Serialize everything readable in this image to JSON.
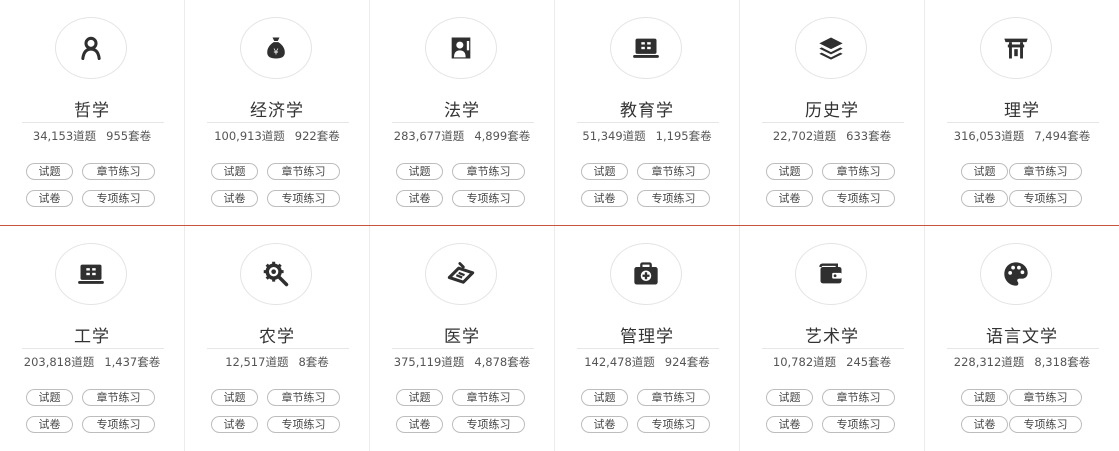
{
  "categories": [
    {
      "name": "哲学",
      "stats": "34,153道题",
      "papers": "955套卷",
      "icon": "person-icon"
    },
    {
      "name": "经济学",
      "stats": "100,913道题",
      "papers": "922套卷",
      "icon": "money-bag-icon"
    },
    {
      "name": "法学",
      "stats": "283,677道题",
      "papers": "4,899套卷",
      "icon": "lecturer-icon"
    },
    {
      "name": "教育学",
      "stats": "51,349道题",
      "papers": "1,195套卷",
      "icon": "laptop-icon"
    },
    {
      "name": "历史学",
      "stats": "22,702道题",
      "papers": "633套卷",
      "icon": "layers-icon"
    },
    {
      "name": "理学",
      "stats": "316,053道题",
      "papers": "7,494套卷",
      "icon": "torii-icon"
    },
    {
      "name": "工学",
      "stats": "203,818道题",
      "papers": "1,437套卷",
      "icon": "laptop-icon"
    },
    {
      "name": "农学",
      "stats": "12,517道题",
      "papers": "8套卷",
      "icon": "gear-tools-icon"
    },
    {
      "name": "医学",
      "stats": "375,119道题",
      "papers": "4,878套卷",
      "icon": "pill-icon"
    },
    {
      "name": "管理学",
      "stats": "142,478道题",
      "papers": "924套卷",
      "icon": "medical-kit-icon"
    },
    {
      "name": "艺术学",
      "stats": "10,782道题",
      "papers": "245套卷",
      "icon": "wallet-icon"
    },
    {
      "name": "语言文学",
      "stats": "228,312道题",
      "papers": "8,318套卷",
      "icon": "palette-icon"
    }
  ],
  "buttons": {
    "questions": "试题",
    "chapter_practice": "章节练习",
    "papers": "试卷",
    "topic_practice": "专项练习"
  },
  "colors": {
    "divider": "#c9533f",
    "icon_fill": "#2f2f2f"
  }
}
